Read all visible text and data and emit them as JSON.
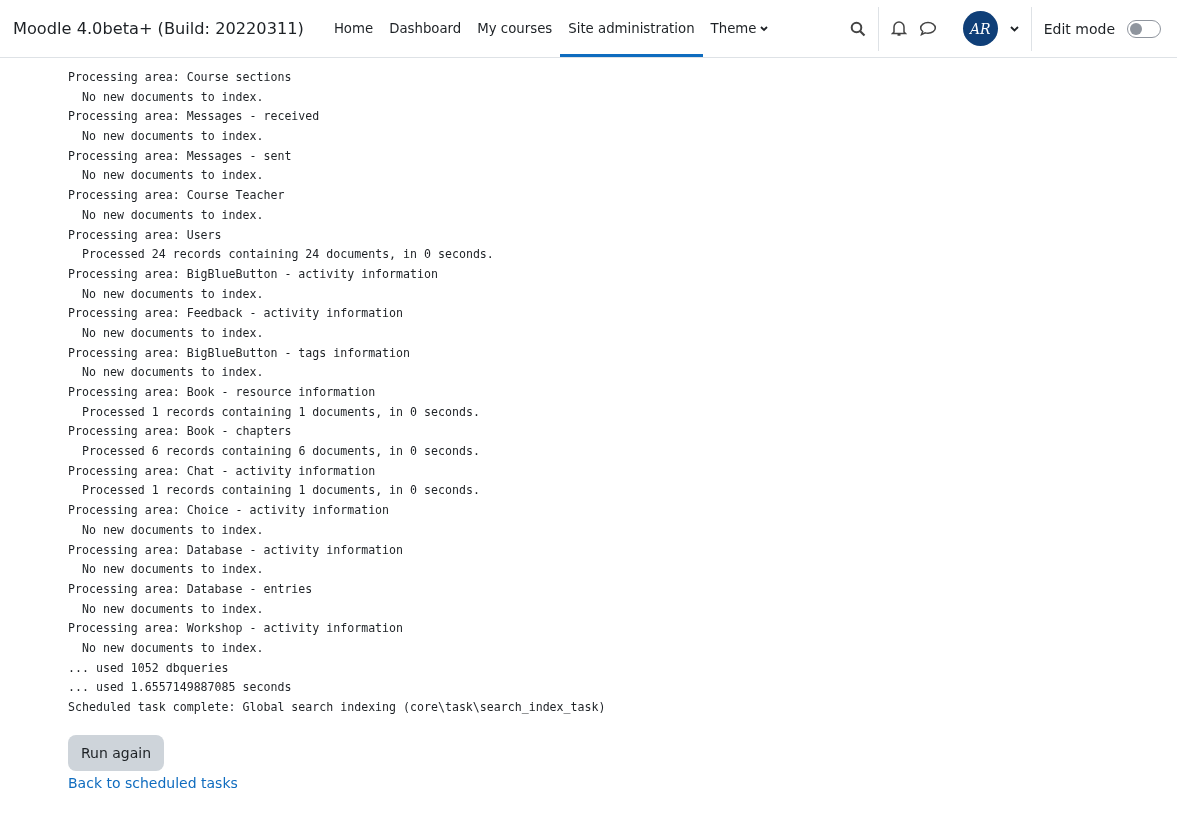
{
  "navbar": {
    "site_name": "Moodle 4.0beta+ (Build: 20220311)",
    "items": [
      {
        "label": "Home",
        "selected": false,
        "dropdown": false
      },
      {
        "label": "Dashboard",
        "selected": false,
        "dropdown": false
      },
      {
        "label": "My courses",
        "selected": false,
        "dropdown": false
      },
      {
        "label": "Site administration",
        "selected": true,
        "dropdown": false
      },
      {
        "label": "Theme",
        "selected": false,
        "dropdown": true
      }
    ],
    "avatar": "AR",
    "edit_mode": {
      "label": "Edit mode",
      "on": false
    }
  },
  "log": [
    {
      "kind": "area",
      "text": "Processing area: Course sections"
    },
    {
      "kind": "detail",
      "text": "No new documents to index."
    },
    {
      "kind": "area",
      "text": "Processing area: Messages - received"
    },
    {
      "kind": "detail",
      "text": "No new documents to index."
    },
    {
      "kind": "area",
      "text": "Processing area: Messages - sent"
    },
    {
      "kind": "detail",
      "text": "No new documents to index."
    },
    {
      "kind": "area",
      "text": "Processing area: Course Teacher"
    },
    {
      "kind": "detail",
      "text": "No new documents to index."
    },
    {
      "kind": "area",
      "text": "Processing area: Users"
    },
    {
      "kind": "detail",
      "text": "Processed 24 records containing 24 documents, in 0 seconds."
    },
    {
      "kind": "area",
      "text": "Processing area: BigBlueButton - activity information"
    },
    {
      "kind": "detail",
      "text": "No new documents to index."
    },
    {
      "kind": "area",
      "text": "Processing area: Feedback - activity information"
    },
    {
      "kind": "detail",
      "text": "No new documents to index."
    },
    {
      "kind": "area",
      "text": "Processing area: BigBlueButton - tags information"
    },
    {
      "kind": "detail",
      "text": "No new documents to index."
    },
    {
      "kind": "area",
      "text": "Processing area: Book - resource information"
    },
    {
      "kind": "detail",
      "text": "Processed 1 records containing 1 documents, in 0 seconds."
    },
    {
      "kind": "area",
      "text": "Processing area: Book - chapters"
    },
    {
      "kind": "detail",
      "text": "Processed 6 records containing 6 documents, in 0 seconds."
    },
    {
      "kind": "area",
      "text": "Processing area: Chat - activity information"
    },
    {
      "kind": "detail",
      "text": "Processed 1 records containing 1 documents, in 0 seconds."
    },
    {
      "kind": "area",
      "text": "Processing area: Choice - activity information"
    },
    {
      "kind": "detail",
      "text": "No new documents to index."
    },
    {
      "kind": "area",
      "text": "Processing area: Database - activity information"
    },
    {
      "kind": "detail",
      "text": "No new documents to index."
    },
    {
      "kind": "area",
      "text": "Processing area: Database - entries"
    },
    {
      "kind": "detail",
      "text": "No new documents to index."
    },
    {
      "kind": "area",
      "text": "Processing area: Workshop - activity information"
    },
    {
      "kind": "detail",
      "text": "No new documents to index."
    },
    {
      "kind": "area",
      "text": "... used 1052 dbqueries"
    },
    {
      "kind": "area",
      "text": "... used 1.6557149887085 seconds"
    },
    {
      "kind": "area",
      "text": "Scheduled task complete: Global search indexing (core\\task\\search_index_task)"
    }
  ],
  "run_button": "Run again",
  "back_link": "Back to scheduled tasks"
}
